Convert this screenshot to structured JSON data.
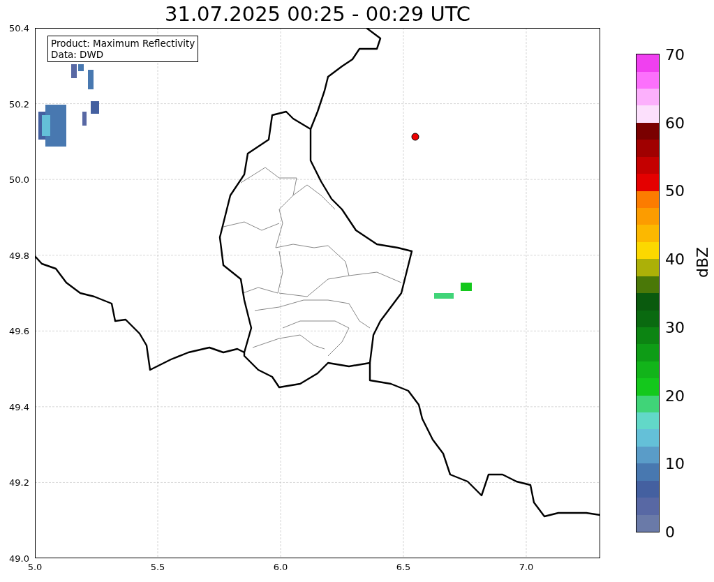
{
  "title": "31.07.2025 00:25 - 00:29 UTC",
  "info_box": {
    "lines": [
      "Product: Maximum Reflectivity",
      "Data: DWD"
    ]
  },
  "map": {
    "x_ticks": [
      "5.0",
      "5.5",
      "6.0",
      "6.5",
      "7.0"
    ],
    "y_ticks": [
      "50.4",
      "50.2",
      "50.0",
      "49.8",
      "49.6",
      "49.4",
      "49.2",
      "49.0"
    ]
  },
  "colorbar": {
    "label": "dBZ",
    "ticks": [
      "70",
      "60",
      "50",
      "40",
      "30",
      "20",
      "10",
      "0"
    ],
    "segments": [
      {
        "color": "#6a7aa8"
      },
      {
        "color": "#5868a4"
      },
      {
        "color": "#4460a0"
      },
      {
        "color": "#4878b0"
      },
      {
        "color": "#5a9cc8"
      },
      {
        "color": "#64c0d8"
      },
      {
        "color": "#62d8c8"
      },
      {
        "color": "#40d478"
      },
      {
        "color": "#14c81c"
      },
      {
        "color": "#12b41a"
      },
      {
        "color": "#0e9c16"
      },
      {
        "color": "#0c8412"
      },
      {
        "color": "#0a6a10"
      },
      {
        "color": "#0a5a0e"
      },
      {
        "color": "#4a7808"
      },
      {
        "color": "#acb008"
      },
      {
        "color": "#fcd800"
      },
      {
        "color": "#fcb800"
      },
      {
        "color": "#fc9c00"
      },
      {
        "color": "#fc7c00"
      },
      {
        "color": "#e40000"
      },
      {
        "color": "#c40000"
      },
      {
        "color": "#a00000"
      },
      {
        "color": "#7a0000"
      },
      {
        "color": "#fce0fc"
      },
      {
        "color": "#fcb0fc"
      },
      {
        "color": "#fc70fc"
      },
      {
        "color": "#f040f0"
      }
    ]
  }
}
